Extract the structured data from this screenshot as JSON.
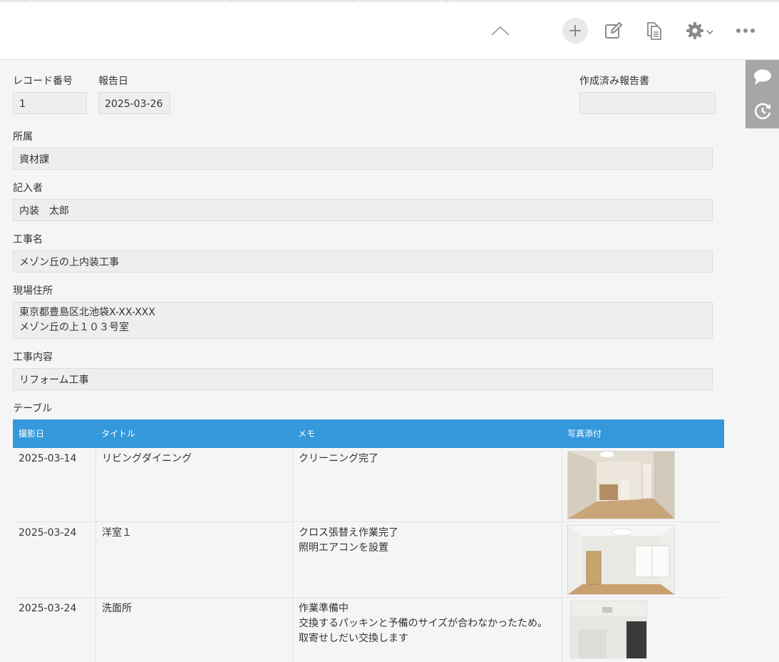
{
  "toolbar": {
    "icons": [
      "chevron-up-icon",
      "plus-icon",
      "edit-icon",
      "copy-icon",
      "gear-icon",
      "more-icon"
    ]
  },
  "side": {
    "icons": [
      "comment-icon",
      "history-icon"
    ]
  },
  "record": {
    "record_number": {
      "label": "レコード番号",
      "value": "1"
    },
    "report_date": {
      "label": "報告日",
      "value": "2025-03-26"
    },
    "created_report": {
      "label": "作成済み報告書",
      "value": ""
    },
    "department": {
      "label": "所属",
      "value": "資材課"
    },
    "author": {
      "label": "記入者",
      "value": "内装　太郎"
    },
    "project_name": {
      "label": "工事名",
      "value": "メゾン丘の上内装工事"
    },
    "site_address": {
      "label": "現場住所",
      "lines": [
        "東京都豊島区北池袋X-XX-XXX",
        "メゾン丘の上１０３号室"
      ]
    },
    "work_content": {
      "label": "工事内容",
      "value": "リフォーム工事"
    }
  },
  "table": {
    "label": "テーブル",
    "header_color": "#3498db",
    "columns": [
      "撮影日",
      "タイトル",
      "メモ",
      "写真添付"
    ],
    "rows": [
      {
        "date": "2025-03-14",
        "title": "リビングダイニング",
        "memo": [
          "クリーニング完了"
        ]
      },
      {
        "date": "2025-03-24",
        "title": "洋室１",
        "memo": [
          "クロス張替え作業完了",
          "照明エアコンを設置"
        ]
      },
      {
        "date": "2025-03-24",
        "title": "洗面所",
        "memo": [
          "作業準備中",
          "交換するパッキンと予備のサイズが合わなかったため。",
          "取寄せしだい交換します"
        ]
      }
    ]
  }
}
